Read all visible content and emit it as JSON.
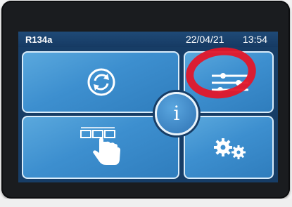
{
  "status": {
    "refrigerant": "R134a",
    "date": "22/04/21",
    "time": "13:54"
  },
  "tiles": [
    {
      "id": "refresh",
      "icon": "refresh-icon"
    },
    {
      "id": "settings",
      "icon": "sliders-icon"
    },
    {
      "id": "menu",
      "icon": "touch-menu-icon"
    },
    {
      "id": "configuration",
      "icon": "gears-icon"
    }
  ],
  "info_button": {
    "glyph": "i"
  },
  "colors": {
    "screen_bg": "#173d66",
    "tile": "#3d8fcf",
    "tile_border": "#d9ecfa",
    "annotation": "#e3172a"
  }
}
